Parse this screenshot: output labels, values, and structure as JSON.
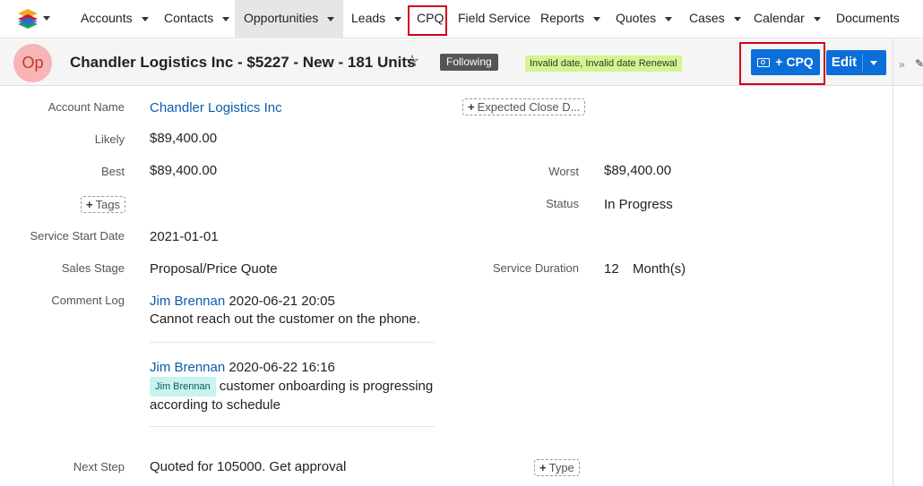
{
  "nav": {
    "items": [
      {
        "label": "Accounts",
        "has_caret": true
      },
      {
        "label": "Contacts",
        "has_caret": true
      },
      {
        "label": "Opportunities",
        "has_caret": true,
        "active": true
      },
      {
        "label": "Leads",
        "has_caret": true
      },
      {
        "label": "CPQ",
        "has_caret": false,
        "highlighted": true
      },
      {
        "label": "Field Service",
        "has_caret": false
      },
      {
        "label": "Reports",
        "has_caret": true
      },
      {
        "label": "Quotes",
        "has_caret": true
      },
      {
        "label": "Cases",
        "has_caret": true
      },
      {
        "label": "Calendar",
        "has_caret": true
      },
      {
        "label": "Documents",
        "has_caret": true
      }
    ],
    "logo_icon": "stacked-layers-icon"
  },
  "record": {
    "avatar": "Op",
    "title": "Chandler Logistics Inc - $5227 - New - 181 Units",
    "following": "Following",
    "warning": "Invalid date, Invalid date Renewal",
    "cpq_button": "+ CPQ",
    "edit_button": "Edit"
  },
  "fields": {
    "account_name_label": "Account Name",
    "account_name": "Chandler Logistics Inc",
    "expected_close": "Expected Close D...",
    "likely_label": "Likely",
    "likely": "$89,400.00",
    "best_label": "Best",
    "best": "$89,400.00",
    "worst_label": "Worst",
    "worst": "$89,400.00",
    "tags": "Tags",
    "status_label": "Status",
    "status": "In Progress",
    "service_start_label": "Service Start Date",
    "service_start": "2021-01-01",
    "sales_stage_label": "Sales Stage",
    "sales_stage": "Proposal/Price Quote",
    "service_duration_label": "Service Duration",
    "service_duration_value": "12",
    "service_duration_unit": "Month(s)",
    "comment_log_label": "Comment Log",
    "comments": [
      {
        "author": "Jim Brennan",
        "time": "2020-06-21 20:05",
        "text": "Cannot reach out the customer on the phone."
      },
      {
        "author": "Jim Brennan",
        "time": "2020-06-22 16:16",
        "mention": "Jim Brennan",
        "text": "customer onboarding is progressing according to schedule"
      }
    ],
    "next_step_label": "Next Step",
    "next_step": "Quoted for 105000. Get approval",
    "type": "Type"
  },
  "colors": {
    "brand_blue": "#0b6ed9",
    "highlight_red": "#d0021b",
    "link": "#0b5cad",
    "warning_bg": "#d3f58d"
  }
}
